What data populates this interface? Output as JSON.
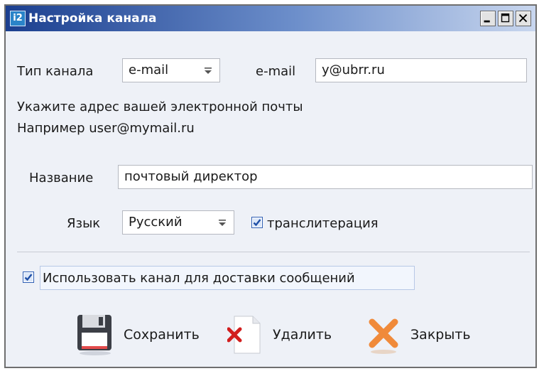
{
  "window": {
    "title": "Настройка канала",
    "app_icon_text": "i2"
  },
  "channel": {
    "type_label": "Тип канала",
    "type_value": "e-mail",
    "email_label": "e-mail",
    "email_value": "y@ubrr.ru"
  },
  "hint": {
    "line1": "Укажите адрес вашей электронной почты",
    "line2": "Например user@mymail.ru"
  },
  "name": {
    "label": "Название",
    "value": "почтовый директор"
  },
  "language": {
    "label": "Язык",
    "value": "Русский",
    "translit_label": "транслитерация",
    "translit_checked": true
  },
  "delivery": {
    "label": "Использовать канал для доставки сообщений",
    "checked": true
  },
  "buttons": {
    "save": "Сохранить",
    "delete": "Удалить",
    "close": "Закрыть"
  },
  "colors": {
    "title_gradient_start": "#1b3f8f",
    "checkbox_blue": "#2f5fb4",
    "delete_red": "#d21e1e",
    "close_orange": "#f08a3a"
  }
}
